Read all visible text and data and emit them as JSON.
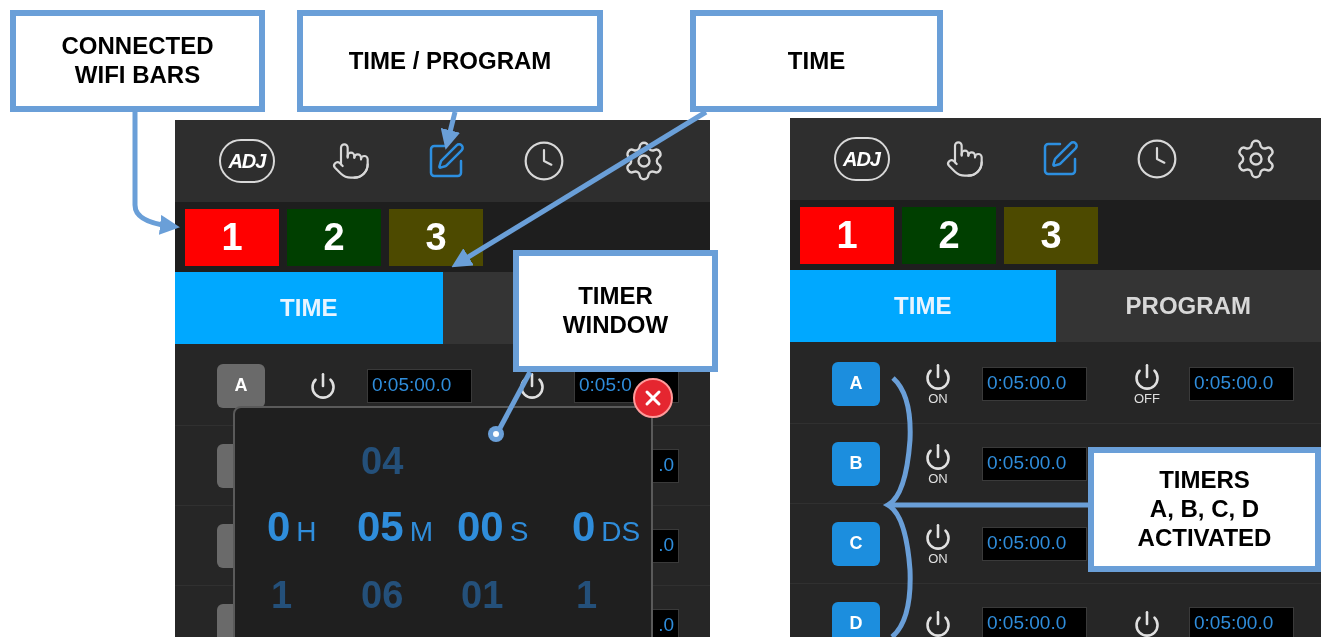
{
  "callouts": [
    {
      "lines": [
        "CONNECTED",
        "WIFI BARS"
      ]
    },
    {
      "lines": [
        "TIME / PROGRAM"
      ]
    },
    {
      "lines": [
        "TIME"
      ]
    },
    {
      "lines": [
        "TIMER",
        "WINDOW"
      ]
    },
    {
      "lines": [
        "TIMERS",
        "A, B, C, D",
        "ACTIVATED"
      ]
    }
  ],
  "screens": [
    {
      "logo": "ADJ",
      "toolbar": [
        {
          "kind": "touch",
          "selected": false
        },
        {
          "kind": "edit",
          "selected": true
        },
        {
          "kind": "clock",
          "selected": false
        },
        {
          "kind": "settings",
          "selected": false
        }
      ],
      "zones": [
        {
          "label": "1",
          "color": "#ff0000"
        },
        {
          "label": "2",
          "color": "#003f00"
        },
        {
          "label": "3",
          "color": "#4d4a00"
        }
      ],
      "tabs": [
        {
          "label": "TIME",
          "selected": true
        },
        {
          "selected": false
        }
      ],
      "timers": [
        {
          "button": "A",
          "active": false,
          "on_time": "0:05:00.0",
          "off_time": "0:05:0"
        },
        {
          "active": false,
          "off_time": ".0"
        },
        {
          "active": false,
          "off_time": ".0"
        },
        {
          "active": false,
          "off_time": ".0"
        }
      ],
      "timer_window": {
        "columns": [
          {
            "value": "0",
            "unit": "H",
            "below": "1"
          },
          {
            "above": "04",
            "value": "05",
            "unit": "M",
            "below": "06"
          },
          {
            "value": "00",
            "unit": "S",
            "below": "01"
          },
          {
            "value": "0",
            "unit": "DS",
            "below": "1"
          }
        ]
      }
    },
    {
      "logo": "ADJ",
      "toolbar": [
        {
          "kind": "touch",
          "selected": false
        },
        {
          "kind": "edit",
          "selected": true
        },
        {
          "kind": "clock",
          "selected": false
        },
        {
          "kind": "settings",
          "selected": false
        }
      ],
      "zones": [
        {
          "label": "1",
          "color": "#ff0000"
        },
        {
          "label": "2",
          "color": "#003f00"
        },
        {
          "label": "3",
          "color": "#4d4a00"
        }
      ],
      "tabs": [
        {
          "label": "TIME",
          "selected": true
        },
        {
          "label": "PROGRAM",
          "selected": false
        }
      ],
      "timers": [
        {
          "button": "A",
          "active": true,
          "on_label": "ON",
          "on_time": "0:05:00.0",
          "off_label": "OFF",
          "off_time": "0:05:00.0"
        },
        {
          "button": "B",
          "active": true,
          "on_label": "ON",
          "on_time": "0:05:00.0"
        },
        {
          "button": "C",
          "active": true,
          "on_label": "ON",
          "on_time": "0:05:00.0"
        },
        {
          "button": "D",
          "active": true,
          "on_time": "0:05:00.0",
          "off_time": "0:05:00.0"
        }
      ]
    }
  ]
}
